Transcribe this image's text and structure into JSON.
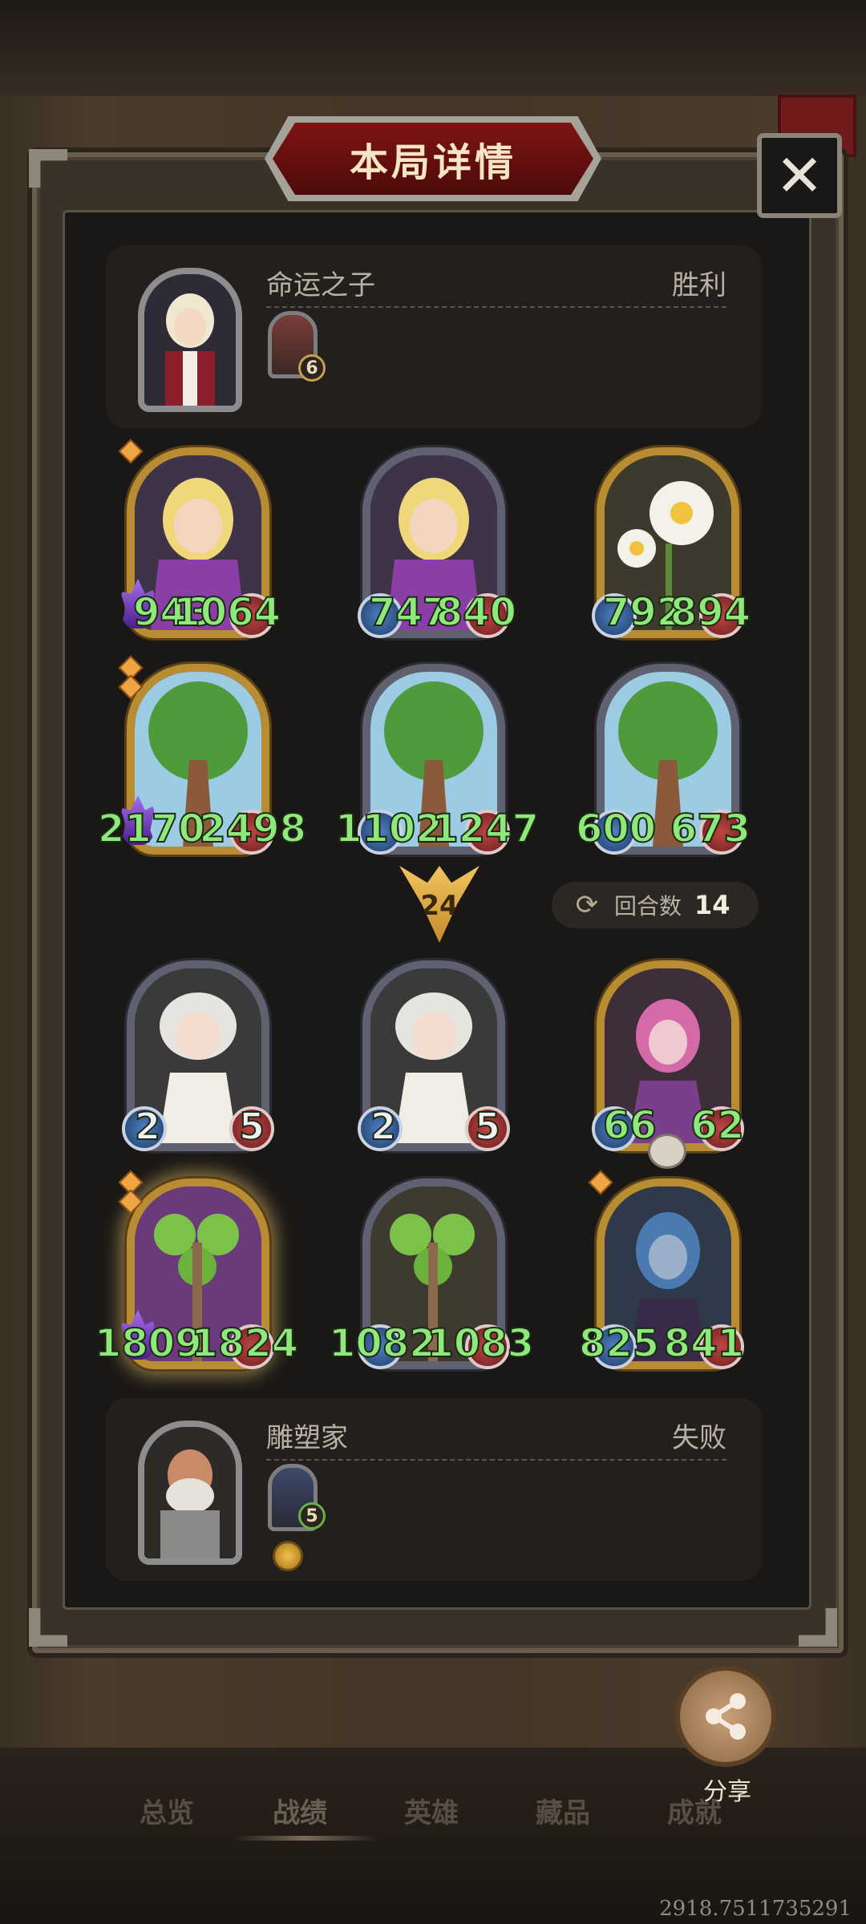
{
  "dialog": {
    "title": "本局详情"
  },
  "winner": {
    "name": "命运之子",
    "result": "胜利",
    "badge": "6"
  },
  "loser": {
    "name": "雕塑家",
    "result": "失败",
    "badge": "5"
  },
  "round": {
    "marker": "24",
    "turns_label": "回合数",
    "turns_value": "14"
  },
  "winner_board": [
    {
      "atk": "943",
      "hp": "1064"
    },
    {
      "atk": "747",
      "hp": "840"
    },
    {
      "atk": "792",
      "hp": "894"
    },
    {
      "atk": "2170",
      "hp": "2498"
    },
    {
      "atk": "1102",
      "hp": "1247"
    },
    {
      "atk": "600",
      "hp": "673"
    }
  ],
  "loser_board": [
    {
      "atk": "2",
      "hp": "5"
    },
    {
      "atk": "2",
      "hp": "5"
    },
    {
      "atk": "66",
      "hp": "62"
    },
    {
      "atk": "1809",
      "hp": "1824"
    },
    {
      "atk": "1082",
      "hp": "1083"
    },
    {
      "atk": "825",
      "hp": "841"
    }
  ],
  "share": {
    "label": "分享"
  },
  "tabs": [
    "总览",
    "战绩",
    "英雄",
    "藏品",
    "成就"
  ],
  "coords_text": "2918.7511735291",
  "icons": [
    "close-icon",
    "share-icon",
    "refresh-icon",
    "skull-icon",
    "gold-coin-icon"
  ]
}
